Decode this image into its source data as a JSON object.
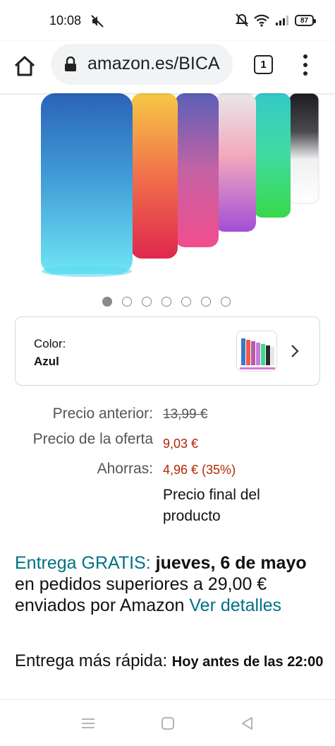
{
  "status_bar": {
    "time": "10:08",
    "battery": "87"
  },
  "browser": {
    "url": "amazon.es/BICA",
    "tab_count": "1"
  },
  "carousel": {
    "dot_count": 7,
    "active_index": 0
  },
  "color_selector": {
    "label": "Color:",
    "value": "Azul"
  },
  "price": {
    "previous_label": "Precio anterior:",
    "previous_value": "13,99 €",
    "deal_label": "Precio de la oferta",
    "deal_value": "9,03 €",
    "savings_label": "Ahorras:",
    "savings_value": "4,96 € (35%)",
    "final_note": "Precio final del producto"
  },
  "delivery": {
    "free_label": "Entrega GRATIS:",
    "date": "jueves, 6 de mayo",
    "condition": "en pedidos superiores a 29,00 € enviados por Amazon",
    "details_link": "Ver detalles"
  },
  "faster_delivery": {
    "label": "Entrega más rápida:",
    "value": "Hoy antes de las 22:00"
  },
  "colors": {
    "accent_teal": "#007185",
    "deal_red": "#b12704"
  }
}
